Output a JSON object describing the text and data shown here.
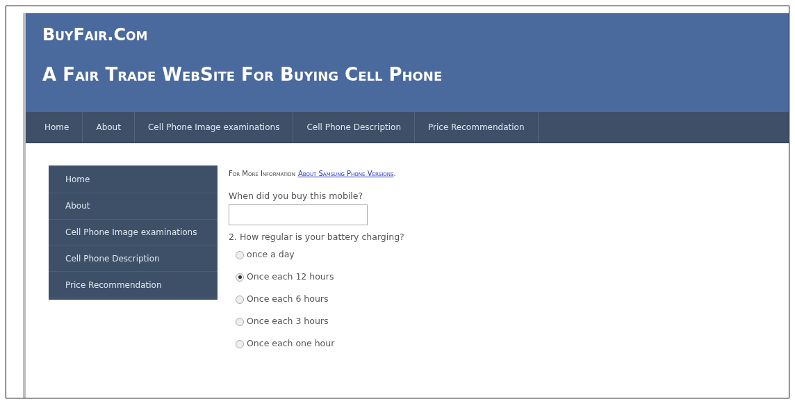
{
  "header": {
    "site_name": "BuyFair.Com",
    "tagline": "A Fair Trade WebSite For Buying Cell Phone"
  },
  "nav": {
    "items": [
      {
        "label": "Home"
      },
      {
        "label": "About"
      },
      {
        "label": "Cell Phone Image examinations"
      },
      {
        "label": "Cell Phone Description"
      },
      {
        "label": "Price Recommendation"
      }
    ]
  },
  "sidebar": {
    "items": [
      {
        "label": "Home"
      },
      {
        "label": "About"
      },
      {
        "label": "Cell Phone Image examinations"
      },
      {
        "label": "Cell Phone Description"
      },
      {
        "label": "Price Recommendation"
      }
    ]
  },
  "info": {
    "text": "For More Information",
    "link": "About Samsung Phone Versions",
    "suffix": "."
  },
  "question_1": {
    "label": "When did you buy this mobile?"
  },
  "question_2": {
    "label": "2. How regular is your battery charging?",
    "options": [
      {
        "label": "once a day",
        "selected": false
      },
      {
        "label": "Once each 12 hours",
        "selected": true
      },
      {
        "label": "Once each 6 hours",
        "selected": false
      },
      {
        "label": "Once each 3 hours",
        "selected": false
      },
      {
        "label": "Once each one hour",
        "selected": false
      }
    ]
  }
}
